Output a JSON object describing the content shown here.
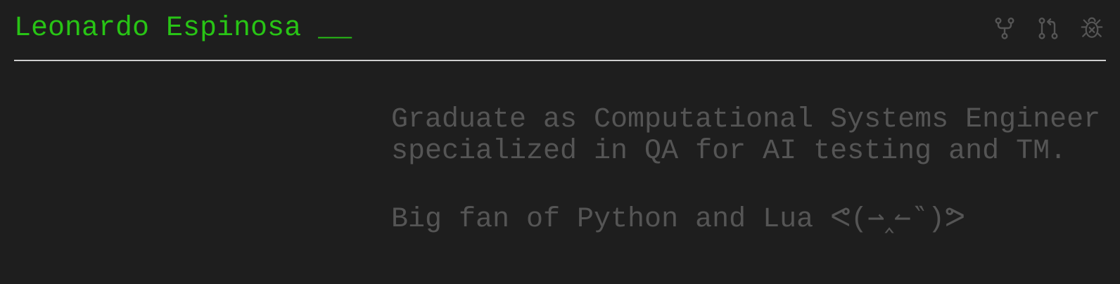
{
  "header": {
    "title": "Leonardo Espinosa",
    "cursor": "__",
    "title_color": "#28c415",
    "icons": [
      "fork-icon",
      "pull-request-icon",
      "bug-icon"
    ]
  },
  "bio": {
    "line1": "Graduate as Computational Systems Engineer",
    "line2": "specialized in QA for AI testing and TM.",
    "line3": "Big fan of Python and Lua ᕙ(⇀‸↼‶)ᕗ"
  },
  "colors": {
    "background": "#1e1e1e",
    "text_muted": "#555555",
    "divider": "#cfcfcf"
  }
}
